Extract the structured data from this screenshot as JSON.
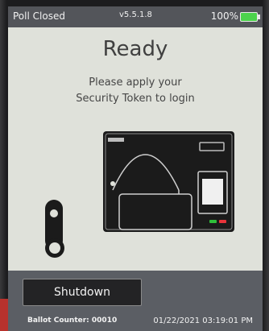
{
  "status": {
    "poll_state": "Poll Closed",
    "version": "v5.5.1.8",
    "battery_percent": "100%"
  },
  "main": {
    "title": "Ready",
    "instruction_line1": "Please apply your",
    "instruction_line2": "Security Token to login"
  },
  "footer": {
    "shutdown_label": "Shutdown",
    "ballot_counter": "Ballot Counter: 00010",
    "datetime": "01/22/2021 03:19:01 PM"
  },
  "icons": {
    "battery": "battery-icon",
    "token": "security-token-icon",
    "device": "voting-device-illustration-icon"
  },
  "colors": {
    "screen_bg": "#dfe1da",
    "status_bar": "#53555a",
    "footer_bg": "#5b5e64",
    "button_bg": "#232325",
    "battery_fill": "#4cd34c",
    "indicator_green": "#2fbf3a",
    "indicator_red": "#e8333a"
  }
}
